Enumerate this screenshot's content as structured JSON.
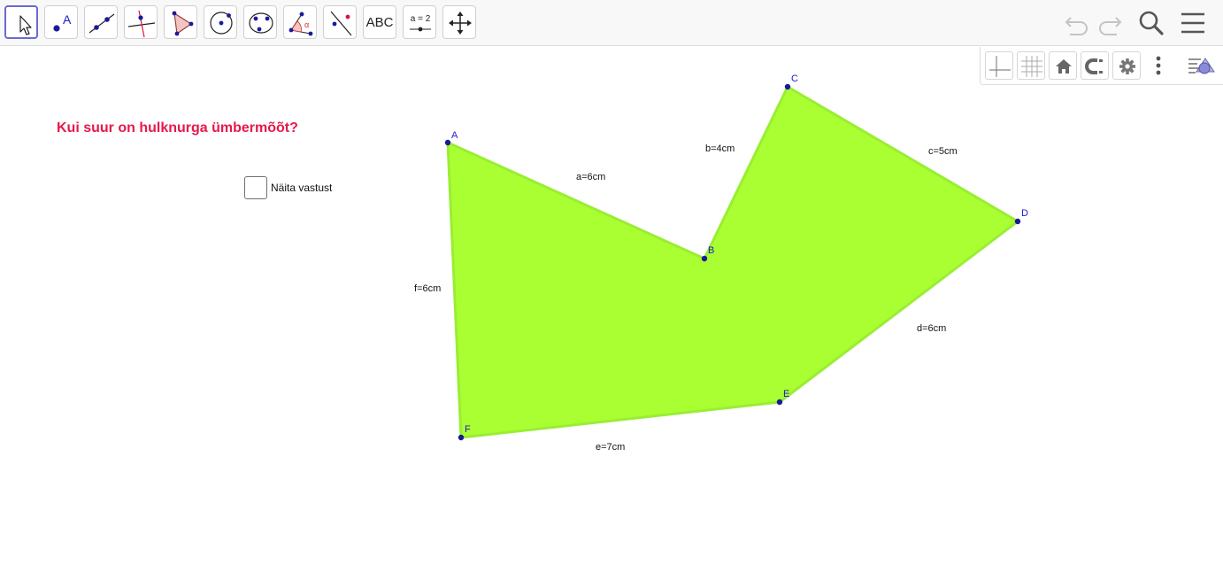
{
  "toolbar": {
    "tools": [
      {
        "name": "move-tool-icon",
        "label": ""
      },
      {
        "name": "point-tool-icon",
        "label": "A"
      },
      {
        "name": "line-tool-icon",
        "label": ""
      },
      {
        "name": "perpendicular-line-tool-icon",
        "label": ""
      },
      {
        "name": "polygon-tool-icon",
        "label": ""
      },
      {
        "name": "circle-tool-icon",
        "label": ""
      },
      {
        "name": "conic-tool-icon",
        "label": ""
      },
      {
        "name": "angle-tool-icon",
        "label": "α"
      },
      {
        "name": "reflect-tool-icon",
        "label": ""
      },
      {
        "name": "text-tool-icon",
        "label": "ABC"
      },
      {
        "name": "slider-tool-icon",
        "label": "a = 2"
      },
      {
        "name": "move-graphics-view-icon",
        "label": ""
      }
    ],
    "right": [
      "undo-icon",
      "redo-icon",
      "search-icon",
      "menu-icon"
    ]
  },
  "stylebar": {
    "buttons": [
      "axes-toggle-icon",
      "grid-toggle-icon",
      "home-icon",
      "point-capture-icon",
      "settings-icon",
      "more-options-icon",
      "algebra-view-toggle-icon"
    ]
  },
  "colors": {
    "polygon_fill": "#aaff33",
    "polygon_stroke": "#99ee33",
    "point": "#1a1a99",
    "point_label": "#1a1acc",
    "question": "#e8184b"
  },
  "question": "Kui suur on hulknurga ümbermõõt?",
  "checkbox": {
    "label": "Näita vastust",
    "checked": false
  },
  "polygon": {
    "points": [
      {
        "name": "A",
        "label": "A"
      },
      {
        "name": "B",
        "label": "B"
      },
      {
        "name": "C",
        "label": "C"
      },
      {
        "name": "D",
        "label": "D"
      },
      {
        "name": "E",
        "label": "E"
      },
      {
        "name": "F",
        "label": "F"
      }
    ],
    "segments": [
      {
        "name": "a",
        "label": "a=6cm"
      },
      {
        "name": "b",
        "label": "b=4cm"
      },
      {
        "name": "c",
        "label": "c=5cm"
      },
      {
        "name": "d",
        "label": "d=6cm"
      },
      {
        "name": "e",
        "label": "e=7cm"
      },
      {
        "name": "f",
        "label": "f=6cm"
      }
    ]
  }
}
